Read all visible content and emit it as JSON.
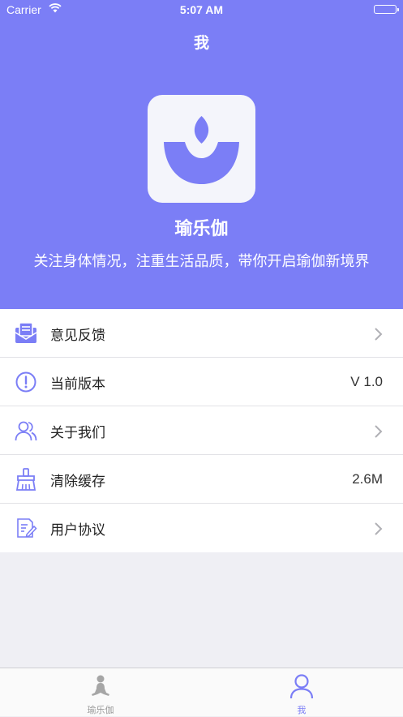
{
  "status_bar": {
    "carrier": "Carrier",
    "time": "5:07 AM"
  },
  "nav": {
    "title": "我"
  },
  "profile": {
    "app_name": "瑜乐伽",
    "slogan": "关注身体情况，注重生活品质，带你开启瑜伽新境界"
  },
  "menu": {
    "items": [
      {
        "label": "意见反馈",
        "icon": "envelope-icon"
      },
      {
        "label": "当前版本",
        "value": "V 1.0",
        "icon": "info-icon"
      },
      {
        "label": "关于我们",
        "icon": "people-icon"
      },
      {
        "label": "清除缓存",
        "value": "2.6M",
        "icon": "broom-icon"
      },
      {
        "label": "用户协议",
        "icon": "document-edit-icon"
      }
    ]
  },
  "tabbar": {
    "tabs": [
      {
        "label": "瑜乐伽",
        "icon": "yoga-icon",
        "active": false
      },
      {
        "label": "我",
        "icon": "user-icon",
        "active": true
      }
    ]
  },
  "colors": {
    "accent": "#7b7ef6",
    "inactive": "#9a9a9a",
    "background": "#efeff4"
  }
}
